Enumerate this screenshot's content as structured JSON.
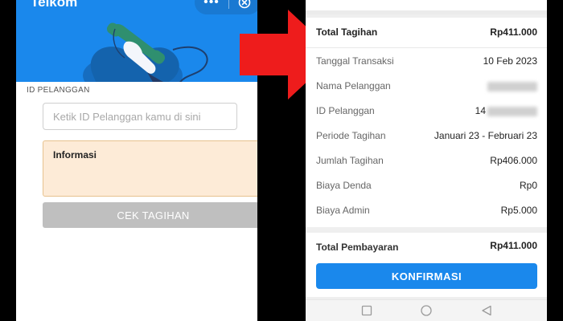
{
  "left": {
    "app_title": "Telkom",
    "menu_dots": "•••",
    "field_label": "ID PELANGGAN",
    "input_placeholder": "Ketik ID Pelanggan kamu di sini",
    "input_value": "",
    "info_title": "Informasi",
    "cek_button": "CEK TAGIHAN"
  },
  "right": {
    "total": {
      "label": "Total Tagihan",
      "value": "Rp411.000"
    },
    "details": [
      {
        "label": "Tanggal Transaksi",
        "value": "10 Feb 2023"
      },
      {
        "label": "Nama Pelanggan",
        "value": ""
      },
      {
        "label": "ID Pelanggan",
        "value": "14"
      },
      {
        "label": "Periode Tagihan",
        "value": "Januari 23 - Februari 23"
      },
      {
        "label": "Jumlah Tagihan",
        "value": "Rp406.000"
      },
      {
        "label": "Biaya Denda",
        "value": "Rp0"
      },
      {
        "label": "Biaya Admin",
        "value": "Rp5.000"
      }
    ],
    "payment": {
      "label": "Total Pembayaran",
      "value": "Rp411.000"
    },
    "confirm_button": "KONFIRMASI"
  },
  "icons": {
    "close": "close-icon",
    "phone": "telephone-illustration",
    "arrow": "red-arrow-icon",
    "nav_recent": "square-icon",
    "nav_home": "circle-icon",
    "nav_back": "triangle-back-icon"
  },
  "colors": {
    "primary_blue": "#1a88ec",
    "info_bg": "#fdebd7",
    "info_border": "#e7c28e",
    "disabled_button": "#bfbfbf",
    "arrow_red": "#ee1c1c"
  }
}
